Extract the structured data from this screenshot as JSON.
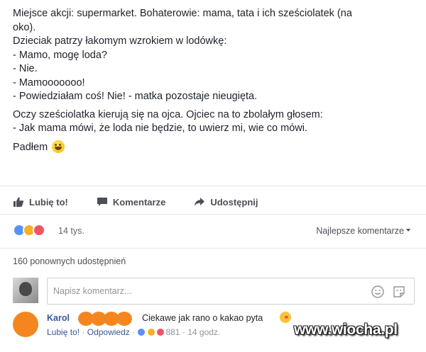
{
  "post": {
    "lines": [
      "Miejsce akcji: supermarket. Bohaterowie: mama, tata i ich sześciolatek (na",
      "oko).",
      "Dzieciak patrzy łakomym wzrokiem w lodówkę:",
      "- Mamo, mogę loda?",
      "- Nie.",
      "- Mamooooooo!",
      "- Powiedziałam coś! Nie! - matka pozostaje nieugięta.",
      "Oczy sześciolatka kierują się na ojca. Ojciec na to zbolałym głosem:",
      "- Jak mama mówi, że loda nie będzie, to uwierz mi, wie co mówi.",
      "Padłem"
    ],
    "emoji_icon": "grinning-face-emoji"
  },
  "actions": {
    "like": "Lubię to!",
    "comment": "Komentarze",
    "share": "Udostępnij"
  },
  "reactions": {
    "count": "14 tys.",
    "sort_label": "Najlepsze komentarze",
    "icons": [
      "like-icon",
      "haha-icon",
      "love-icon"
    ],
    "colors": {
      "like": "#5890ff",
      "haha": "#f7b125",
      "love": "#f25268"
    }
  },
  "shares": {
    "label": "160 ponownych udostępnień"
  },
  "composer": {
    "placeholder": "Napisz komentarz..."
  },
  "comment": {
    "author": "Karol",
    "text": "Ciekawe jak rano o kakao pyta",
    "like": "Lubię to!",
    "reply": "Odpowiedz",
    "reaction_count": "881",
    "time": "14 godz."
  },
  "watermark": "www.wiocha.pl",
  "colors": {
    "link": "#365899",
    "text": "#1d2129",
    "muted": "#90949c",
    "avatar": "#f5861f"
  }
}
